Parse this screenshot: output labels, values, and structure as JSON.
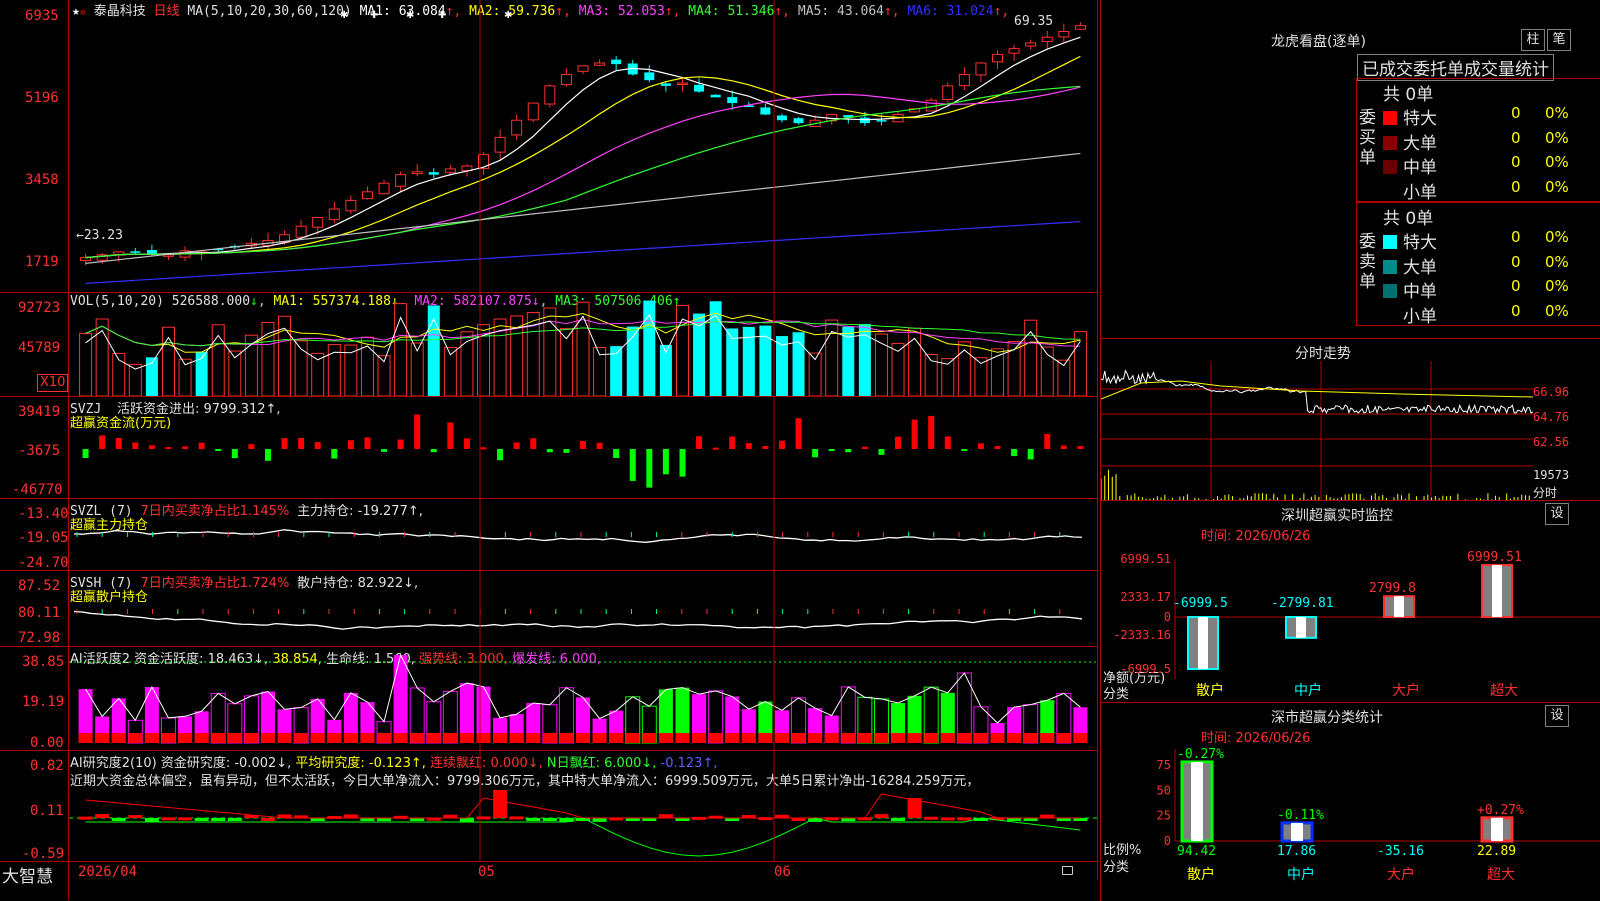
{
  "stock": {
    "name": "泰晶科技",
    "period": "日线"
  },
  "main": {
    "ma_params": "MA(5,10,20,30,60,120)",
    "ma_values": [
      {
        "label": "MA1:",
        "value": "63.084",
        "arrow": "↑",
        "color": "#ffffff"
      },
      {
        "label": "MA2:",
        "value": "59.736",
        "arrow": "↑",
        "color": "#ffff00"
      },
      {
        "label": "MA3:",
        "value": "52.053",
        "arrow": "↑",
        "color": "#ff40ff"
      },
      {
        "label": "MA4:",
        "value": "51.346",
        "arrow": "↑",
        "color": "#30ff30"
      },
      {
        "label": "MA5:",
        "value": "43.064",
        "arrow": "↑",
        "color": "#c0c0c0"
      },
      {
        "label": "MA6:",
        "value": "31.024",
        "arrow": "↑",
        "color": "#3030ff"
      }
    ],
    "y_labels": [
      "6935",
      "5196",
      "3458",
      "1719"
    ],
    "high_label": "69.35",
    "low_label": "23.23"
  },
  "vol": {
    "title": "VOL(5,10,20)",
    "value": "526588.000",
    "arrow": "↓",
    "ma1": "MA1: 557374.188↓",
    "ma2": "MA2: 582107.875↓",
    "ma3": "MA3: 507506.406↑",
    "y_labels": [
      "92723",
      "45789"
    ],
    "unit": "X10"
  },
  "svzj": {
    "title": "SVZJ",
    "desc": "活跃资金进出: 9799.312↑,",
    "sub": "超赢资金流(万元)",
    "y_labels": [
      "39419",
      "-3675",
      "-46770"
    ]
  },
  "svzl": {
    "title": "SVZL (7)",
    "desc": "7日内买卖净占比1.145%",
    "main_hold": "主力持仓: -19.277↑,",
    "sub": "超赢主力持仓",
    "y_labels": [
      "-13.40",
      "-19.05",
      "-24.70"
    ]
  },
  "svsh": {
    "title": "SVSH (7)",
    "desc": "7日内买卖净占比1.724%",
    "retail_hold": "散户持仓: 82.922↓,",
    "sub": "超赢散户持仓",
    "y_labels": [
      "87.52",
      "80.11",
      "72.98"
    ]
  },
  "ai_active": {
    "title": "AI活跃度2",
    "desc": "资金活跃度: 18.463↓,",
    "v2": "38.854,",
    "life": "生命线: 1.560,",
    "strong": "强势线: 3.000,",
    "burst": "爆发线: 6.000,",
    "y_labels": [
      "38.85",
      "19.19",
      "0.00"
    ]
  },
  "ai_research": {
    "title": "AI研究度2(10)",
    "desc": "资金研究度: -0.002↓,",
    "avg": "平均研究度: -0.123↑,",
    "red": "连续飘红: 0.000↓,",
    "nred": "N日飘红: 6.000↓,",
    "last": "-0.123↑,",
    "comment": "近期大资金总体偏空，虽有异动，但不太活跃，今日大单净流入：9799.306万元，其中特大单净流入：6999.509万元，大单5日累计净出-16284.259万元，",
    "y_labels": [
      "0.82",
      "0.11",
      "-0.59"
    ]
  },
  "footer": {
    "brand": "大智慧",
    "date": "2026/04",
    "months": [
      "05",
      "06"
    ]
  },
  "dragon": {
    "title": "龙虎看盘(逐单)",
    "btn_col": "柱",
    "btn_pen": "笔",
    "tab": "已成交委托单成交量统计",
    "buy": {
      "side": "委买单",
      "total": "共 0单",
      "rows": [
        {
          "name": "特大",
          "v": "0",
          "p": "0%",
          "color": "#ff0000"
        },
        {
          "name": "大单",
          "v": "0",
          "p": "0%",
          "color": "#8b0000"
        },
        {
          "name": "中单",
          "v": "0",
          "p": "0%",
          "color": "#6b0000"
        },
        {
          "name": "小单",
          "v": "0",
          "p": "0%",
          "color": ""
        }
      ]
    },
    "sell": {
      "side": "委卖单",
      "total": "共 0单",
      "rows": [
        {
          "name": "特大",
          "v": "0",
          "p": "0%",
          "color": "#00ffff"
        },
        {
          "name": "大单",
          "v": "0",
          "p": "0%",
          "color": "#008b8b"
        },
        {
          "name": "中单",
          "v": "0",
          "p": "0%",
          "color": "#007070"
        },
        {
          "name": "小单",
          "v": "0",
          "p": "0%",
          "color": ""
        }
      ]
    }
  },
  "minute": {
    "title": "分时走势",
    "y_labels": [
      "66.96",
      "64.76",
      "62.56"
    ],
    "vol_label": "19573",
    "foot": "分时"
  },
  "sz_monitor": {
    "title": "深圳超赢实时监控",
    "btn": "设",
    "time": "时间: 2026/06/26",
    "y_labels": [
      "6999.51",
      "2333.17",
      "0",
      "-2333.16",
      "-6999.5"
    ],
    "net_label": "净额(万元)",
    "cat_label": "分类",
    "categories": [
      "散户",
      "中户",
      "大户",
      "超大"
    ],
    "values": [
      -6999.5,
      -2799.81,
      2799.8,
      6999.51
    ],
    "value_labels": [
      "-6999.5",
      "-2799.81",
      "2799.8",
      "6999.51"
    ]
  },
  "sz_class": {
    "title": "深市超赢分类统计",
    "btn": "设",
    "time": "时间: 2026/06/26",
    "y_labels": [
      "75",
      "50",
      "25",
      "0"
    ],
    "ratio_label": "比例%",
    "cat_label": "分类",
    "categories": [
      "散户",
      "中户",
      "大户",
      "超大"
    ],
    "bar_values": [
      94.42,
      17.86,
      0,
      22.89
    ],
    "top_labels": [
      "-0.27%",
      "-0.11%",
      "",
      "+0.27%"
    ],
    "bottom_labels": [
      "94.42",
      "17.86",
      "-35.16",
      "22.89"
    ]
  }
}
